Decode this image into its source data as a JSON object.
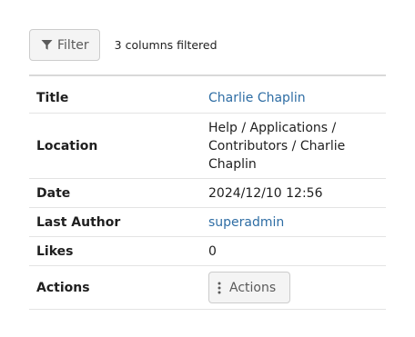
{
  "toolbar": {
    "filter_label": "Filter",
    "filter_status": "3 columns filtered"
  },
  "details": {
    "title_label": "Title",
    "title_value": "Charlie Chaplin",
    "location_label": "Location",
    "location_value": "Help / Applications / Contributors / Charlie Chaplin",
    "date_label": "Date",
    "date_value": "2024/12/10 12:56",
    "author_label": "Last Author",
    "author_value": "superadmin",
    "likes_label": "Likes",
    "likes_value": "0",
    "actions_label": "Actions",
    "actions_button_label": "Actions"
  },
  "icons": {
    "filter": "filter-icon",
    "actions": "vertical-ellipsis-icon"
  },
  "colors": {
    "link": "#2e6da4",
    "button_bg": "#f4f4f4",
    "button_border": "#cccccc"
  }
}
